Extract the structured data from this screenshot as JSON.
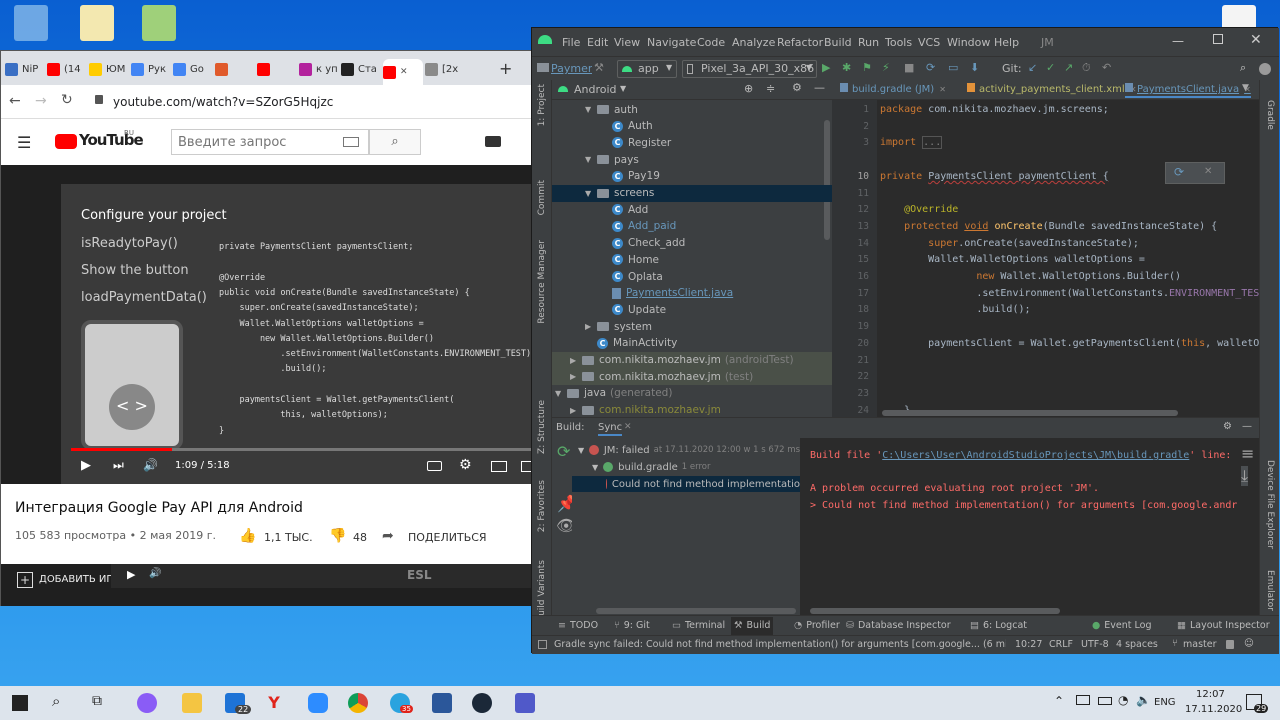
{
  "chrome": {
    "tabs": [
      "NiP",
      "(14",
      "ЮМ",
      "Рук",
      "Go",
      "",
      "",
      "к уп",
      "Ста",
      "",
      "[2x"
    ],
    "new_tab": "+",
    "url": "youtube.com/watch?v=SZorG5Hqjzc",
    "logo": "YouTube",
    "logo_region": "RU",
    "search_placeholder": "Введите запрос",
    "video": {
      "slide_title": "Configure your project",
      "steps": [
        "isReadytoPay()",
        "Show the button",
        "loadPaymentData()"
      ],
      "code": [
        "private PaymentsClient paymentsClient;",
        "",
        "@Override",
        "public void onCreate(Bundle savedInstanceState) {",
        "    super.onCreate(savedInstanceState);",
        "    Wallet.WalletOptions walletOptions =",
        "        new Wallet.WalletOptions.Builder()",
        "            .setEnvironment(WalletConstants.ENVIRONMENT_TEST)",
        "            .build();",
        "",
        "    paymentsClient = Wallet.getPaymentsClient(",
        "            this, walletOptions);",
        "}"
      ],
      "time": "1:09 / 5:18",
      "progress": 0.22
    },
    "video_title": "Интеграция Google Pay API для Android",
    "views": "105 583 просмотра • 2 мая 2019 г.",
    "likes": "1,1 ТЫС.",
    "dislikes": "48",
    "share": "ПОДЕЛИТЬСЯ",
    "add": "ДОБАВИТЬ ИП",
    "esl": "ESL"
  },
  "as": {
    "menu": [
      "File",
      "Edit",
      "View",
      "Navigate",
      "Code",
      "Analyze",
      "Refactor",
      "Build",
      "Run",
      "Tools",
      "VCS",
      "Window",
      "Help",
      "JM"
    ],
    "toolbar": {
      "project": "Paymer",
      "module": "app",
      "device": "Pixel_3a_API_30_x86",
      "git": "Git:"
    },
    "project_header": "Android",
    "tree": [
      {
        "d": 3,
        "t": "auth",
        "k": "folder",
        "a": "▼"
      },
      {
        "d": 4,
        "t": "Auth",
        "k": "class"
      },
      {
        "d": 4,
        "t": "Register",
        "k": "class"
      },
      {
        "d": 3,
        "t": "pays",
        "k": "folder",
        "a": "▼"
      },
      {
        "d": 4,
        "t": "Pay19",
        "k": "class"
      },
      {
        "d": 3,
        "t": "screens",
        "k": "folder",
        "a": "▼",
        "sel": true
      },
      {
        "d": 4,
        "t": "Add",
        "k": "class"
      },
      {
        "d": 4,
        "t": "Add_paid",
        "k": "class",
        "c": "#6897bb"
      },
      {
        "d": 4,
        "t": "Check_add",
        "k": "class"
      },
      {
        "d": 4,
        "t": "Home",
        "k": "class"
      },
      {
        "d": 4,
        "t": "Oplata",
        "k": "class"
      },
      {
        "d": 4,
        "t": "PaymentsClient.java",
        "k": "file",
        "c": "#6897bb",
        "u": true
      },
      {
        "d": 4,
        "t": "Update",
        "k": "class"
      },
      {
        "d": 3,
        "t": "system",
        "k": "folder",
        "a": "▶"
      },
      {
        "d": 3,
        "t": "MainActivity",
        "k": "class"
      },
      {
        "d": 2,
        "t": "com.nikita.mozhaev.jm",
        "k": "folder",
        "a": "▶",
        "s": "(androidTest)",
        "g": true
      },
      {
        "d": 2,
        "t": "com.nikita.mozhaev.jm",
        "k": "folder",
        "a": "▶",
        "s": "(test)",
        "g": true
      },
      {
        "d": 1,
        "t": "java",
        "k": "folder",
        "a": "▼",
        "s": "(generated)"
      },
      {
        "d": 2,
        "t": "com.nikita.mozhaev.jm",
        "k": "folder",
        "a": "▶",
        "c": "#8a8a3a"
      }
    ],
    "editor_tabs": [
      "build.gradle (JM)",
      "activity_payments_client.xml",
      "PaymentsClient.java"
    ],
    "line_numbers": [
      "1",
      "2",
      "3",
      "",
      "10",
      "11",
      "12",
      "13",
      "14",
      "15",
      "16",
      "17",
      "18",
      "19",
      "20",
      "21",
      "22",
      "23",
      "24"
    ],
    "code": [
      {
        "n": 0,
        "h": "<span class='kw'>package</span> com.nikita.mozhaev.jm.screens;"
      },
      {
        "n": 2,
        "h": "<span class='kw'>import</span> <span style='color:#808080;border:1px solid #555'>...</span>"
      },
      {
        "n": 4,
        "h": "<span class='kw'>private</span> <span style='text-decoration:underline wavy #bc3f3c'>PaymentsClient paymentClient {</span>"
      },
      {
        "n": 6,
        "h": "    <span class='an'>@Override</span>"
      },
      {
        "n": 7,
        "h": "    <span class='kw'>protected</span> <span class='kw' style='text-decoration:underline'>void</span> <span class='fn'>onCreate</span>(Bundle savedInstanceState) {"
      },
      {
        "n": 8,
        "h": "        <span class='kw'>super</span>.onCreate(savedInstanceState);"
      },
      {
        "n": 9,
        "h": "        Wallet.WalletOptions walletOptions ="
      },
      {
        "n": 10,
        "h": "                <span class='kw'>new</span> Wallet.WalletOptions.Builder()"
      },
      {
        "n": 11,
        "h": "                .setEnvironment(WalletConstants.<span class='fld'>ENVIRONMENT_TEST</span>"
      },
      {
        "n": 12,
        "h": "                .build();"
      },
      {
        "n": 14,
        "h": "        paymentsClient = Wallet.getPaymentsClient(<span class='kw'>this</span>, walletO"
      },
      {
        "n": 18,
        "h": "    }"
      }
    ],
    "build_label": "Build:",
    "sync_tab": "Sync",
    "build_tree": [
      {
        "t": "JM: failed",
        "s": "at 17.11.2020 12:00 w 1 s 672 ms",
        "i": "err"
      },
      {
        "t": "build.gradle",
        "s": "1 error",
        "i": "ok"
      },
      {
        "t": "Could not find method implementatio",
        "s": "",
        "i": "err",
        "sel": true
      }
    ],
    "build_out": {
      "l1_pre": "Build file '",
      "l1_link": "C:\\Users\\User\\AndroidStudioProjects\\JM\\build.gradle",
      "l1_post": "' line:",
      "l2": "A problem occurred evaluating root project 'JM'.",
      "l3": "> Could not find method implementation() for arguments [com.google.andr"
    },
    "bottom_tabs": [
      "TODO",
      "9: Git",
      "Terminal",
      "Build",
      "Profiler",
      "Database Inspector",
      "6: Logcat",
      "Event Log",
      "Layout Inspector"
    ],
    "status": {
      "msg": "Gradle sync failed: Could not find method implementation() for arguments [com.google... (6 minutes ag",
      "pos": "10:27",
      "le": "CRLF",
      "enc": "UTF-8",
      "indent": "4 spaces",
      "branch": "master"
    },
    "left_strip": [
      "1: Project",
      "Commit",
      "Resource Manager",
      "Z: Structure",
      "2: Favorites",
      "Build Variants"
    ],
    "right_strip": [
      "Gradle",
      "Device File Explorer",
      "Emulator"
    ]
  },
  "taskbar": {
    "lang": "ENG",
    "time": "12:07",
    "date": "17.11.2020",
    "badge_mail": "22",
    "badge_notif": "29",
    "badge_tg": "35"
  }
}
